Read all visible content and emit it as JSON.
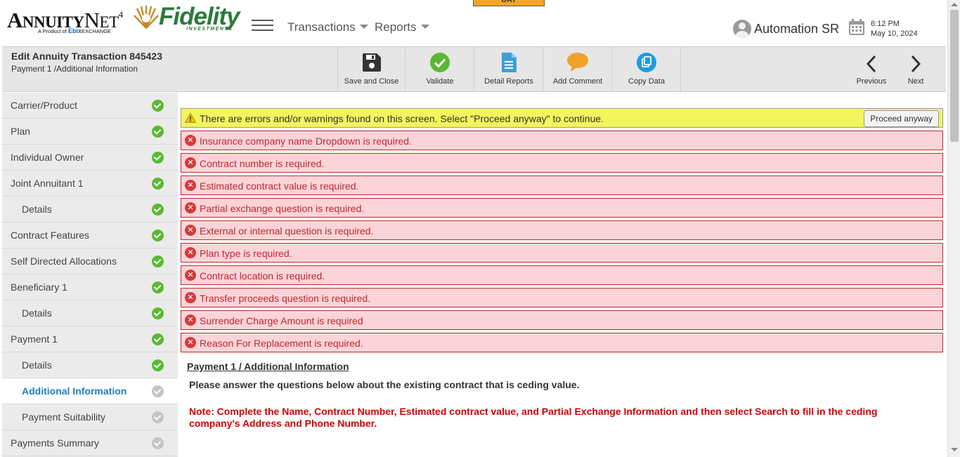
{
  "env_badge": "UAT",
  "header": {
    "annuity_logo": "AnnuityNet4",
    "annuity_tagline": "A Product of Ebix Exchange",
    "fidelity_logo": "Fidelity",
    "fidelity_tagline": "INVESTMENTS",
    "menu": [
      {
        "label": "Transactions"
      },
      {
        "label": "Reports"
      }
    ],
    "user_name": "Automation SR",
    "time": "6:12 PM",
    "date": "May 10, 2024"
  },
  "transaction": {
    "title": "Edit Annuity Transaction 845423",
    "breadcrumb": "Payment 1 /Additional Information"
  },
  "toolbar": {
    "buttons": [
      {
        "label": "Save and Close",
        "icon": "save-icon"
      },
      {
        "label": "Validate",
        "icon": "validate-check-icon"
      },
      {
        "label": "Detail Reports",
        "icon": "document-icon"
      },
      {
        "label": "Add Comment",
        "icon": "comment-icon"
      },
      {
        "label": "Copy Data",
        "icon": "copy-icon"
      }
    ],
    "previous": "Previous",
    "next": "Next"
  },
  "sidebar": {
    "items": [
      {
        "label": "Carrier/Product",
        "status": "complete"
      },
      {
        "label": "Plan",
        "status": "complete"
      },
      {
        "label": "Individual Owner",
        "status": "complete"
      },
      {
        "label": "Joint Annuitant 1",
        "status": "complete"
      },
      {
        "label": "Details",
        "status": "complete",
        "sub": true
      },
      {
        "label": "Contract Features",
        "status": "complete"
      },
      {
        "label": "Self Directed Allocations",
        "status": "complete"
      },
      {
        "label": "Beneficiary 1",
        "status": "complete"
      },
      {
        "label": "Details",
        "status": "complete",
        "sub": true
      },
      {
        "label": "Payment 1",
        "status": "complete"
      },
      {
        "label": "Details",
        "status": "complete",
        "sub": true
      },
      {
        "label": "Additional Information",
        "status": "incomplete",
        "sub": true,
        "active": true
      },
      {
        "label": "Payment Suitability",
        "status": "incomplete",
        "sub": true
      },
      {
        "label": "Payments Summary",
        "status": "incomplete"
      }
    ]
  },
  "main": {
    "warning": "There are errors and/or warnings found on this screen. Select \"Proceed anyway\" to continue.",
    "proceed_label": "Proceed anyway",
    "errors": [
      "Insurance company name Dropdown is required.",
      "Contract number is required.",
      "Estimated contract value is required.",
      "Partial exchange question is required.",
      "External or internal question is required.",
      "Plan type is required.",
      "Contract location is required.",
      "Transfer proceeds question is required.",
      "Surrender Charge Amount is required",
      "Reason For Replacement is required."
    ],
    "section_title": "Payment 1 / Additional Information",
    "instruction": "Please answer the questions below about the existing contract that is ceding value.",
    "note": "Note: Complete the Name, Contract Number, Estimated contract value, and Partial Exchange Information and then select Search to fill in the ceding company's Address and Phone Number."
  },
  "colors": {
    "accent_blue": "#1e7fc2",
    "success_green": "#5cb832",
    "error_red": "#c0272d",
    "warning_yellow": "#f4f45e",
    "fidelity_green": "#2b7a3b"
  }
}
